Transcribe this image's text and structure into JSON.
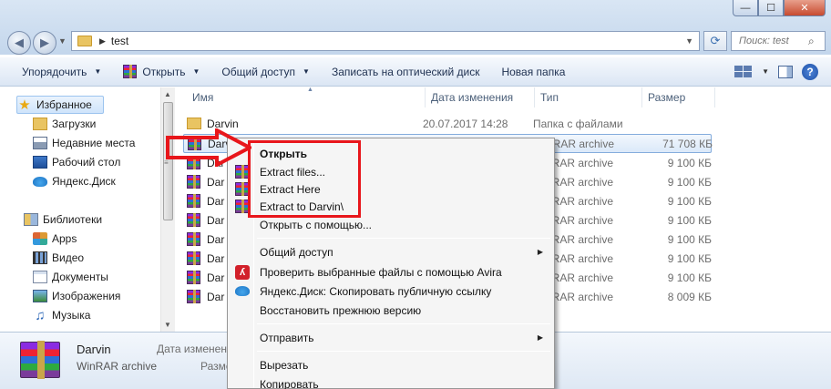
{
  "window": {
    "min_glyph": "—",
    "max_glyph": "☐",
    "close_glyph": "✕"
  },
  "address": {
    "path": "test",
    "search_placeholder": "Поиск: test"
  },
  "toolbar": {
    "organize": "Упорядочить",
    "open": "Открыть",
    "share": "Общий доступ",
    "burn": "Записать на оптический диск",
    "new_folder": "Новая папка",
    "help": "?"
  },
  "nav": {
    "favorites": "Избранное",
    "downloads": "Загрузки",
    "recent": "Недавние места",
    "desktop": "Рабочий стол",
    "yandex_disk": "Яндекс.Диск",
    "libraries": "Библиотеки",
    "apps": "Apps",
    "video": "Видео",
    "documents": "Документы",
    "images": "Изображения",
    "music": "Музыка"
  },
  "columns": {
    "name": "Имя",
    "date": "Дата изменения",
    "type": "Тип",
    "size": "Размер"
  },
  "files": [
    {
      "name": "Darvin",
      "date": "20.07.2017 14:28",
      "type": "Папка с файлами",
      "size": ""
    },
    {
      "name": "Darvin",
      "date": "",
      "type": "WinRAR archive",
      "size": "71 708 КБ"
    },
    {
      "name": "Dar",
      "date": "",
      "type": "WinRAR archive",
      "size": "9 100 КБ"
    },
    {
      "name": "Dar",
      "date": "",
      "type": "WinRAR archive",
      "size": "9 100 КБ"
    },
    {
      "name": "Dar",
      "date": "",
      "type": "WinRAR archive",
      "size": "9 100 КБ"
    },
    {
      "name": "Dar",
      "date": "",
      "type": "WinRAR archive",
      "size": "9 100 КБ"
    },
    {
      "name": "Dar",
      "date": "",
      "type": "WinRAR archive",
      "size": "9 100 КБ"
    },
    {
      "name": "Dar",
      "date": "",
      "type": "WinRAR archive",
      "size": "9 100 КБ"
    },
    {
      "name": "Dar",
      "date": "",
      "type": "WinRAR archive",
      "size": "9 100 КБ"
    },
    {
      "name": "Dar",
      "date": "",
      "type": "WinRAR archive",
      "size": "8 009 КБ"
    }
  ],
  "details": {
    "name": "Darvin",
    "type": "WinRAR archive",
    "label_date": "Дата изменен",
    "label_size": "Разме"
  },
  "context_menu": {
    "open": "Открыть",
    "extract_files": "Extract files...",
    "extract_here": "Extract Here",
    "extract_to": "Extract to Darvin\\",
    "open_with": "Открыть с помощью...",
    "share": "Общий доступ",
    "avira_scan": "Проверить выбранные файлы с помощью Avira",
    "yandex_copy_link": "Яндекс.Диск: Скопировать публичную ссылку",
    "restore_version": "Восстановить прежнюю версию",
    "send_to": "Отправить",
    "cut": "Вырезать",
    "copy": "Копировать"
  },
  "colors": {
    "highlight_red": "#e8161b",
    "selection_blue": "#cfe4fb"
  }
}
